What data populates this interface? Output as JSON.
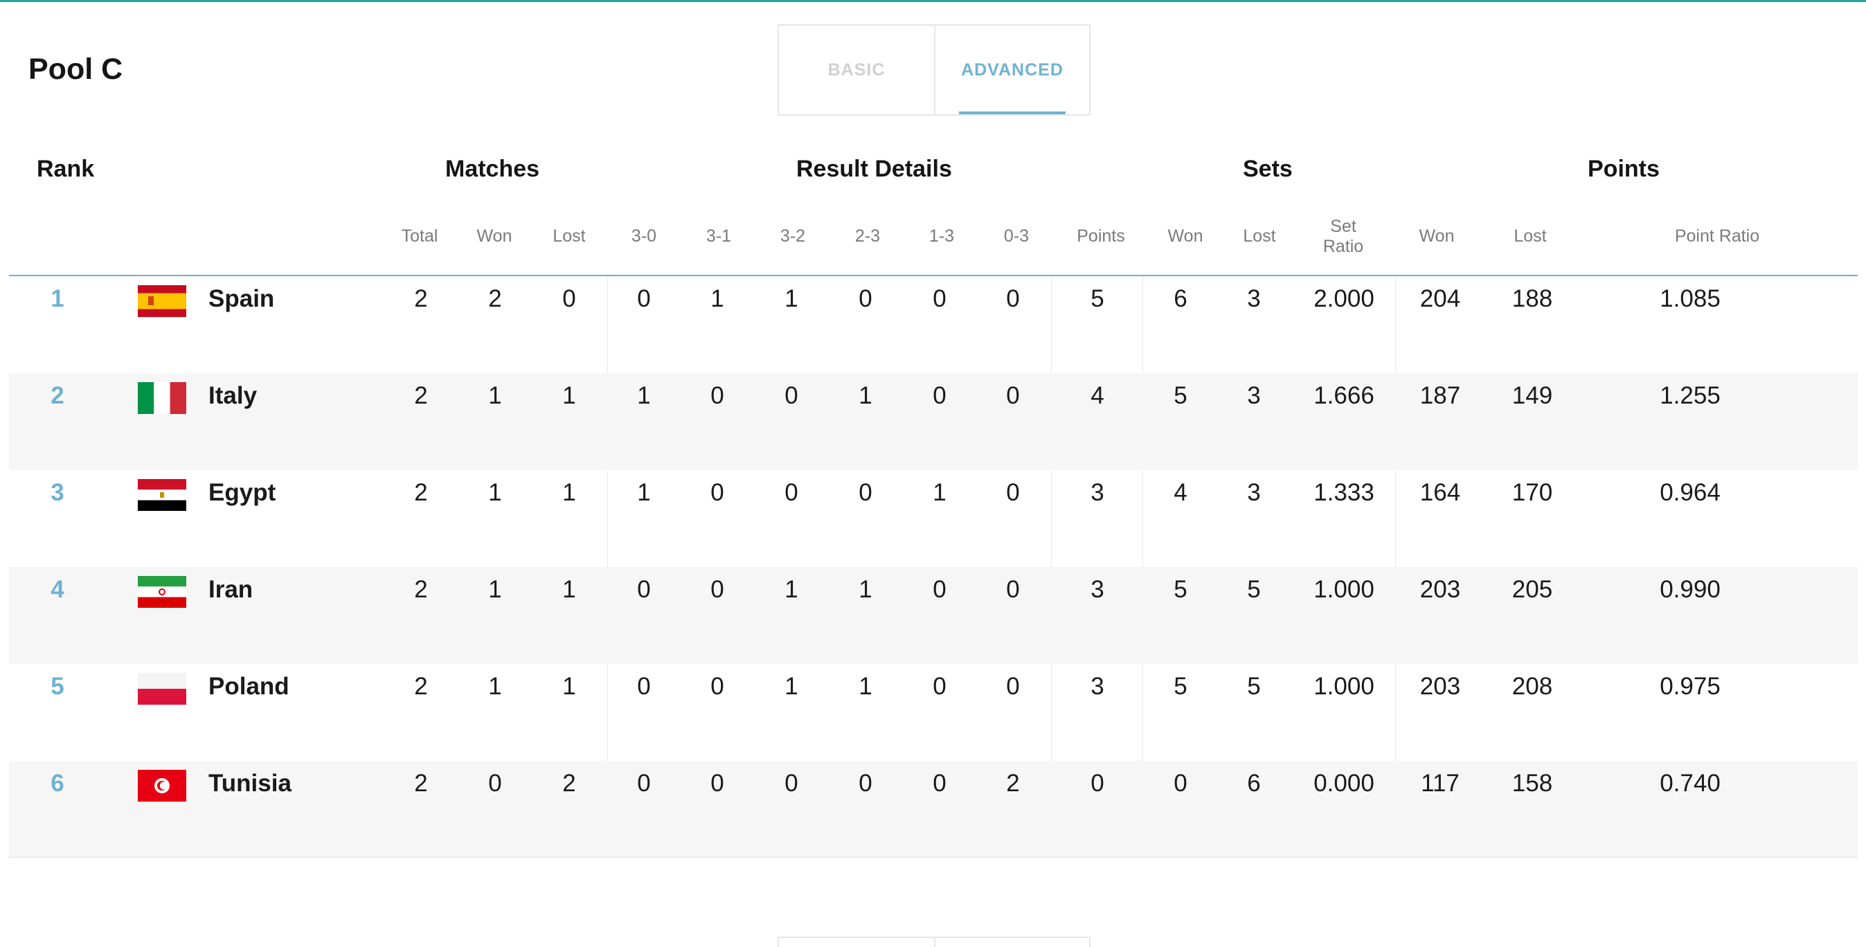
{
  "pool_title": "Pool C",
  "tabs": [
    {
      "label": "BASIC",
      "active": false
    },
    {
      "label": "ADVANCED",
      "active": true
    }
  ],
  "headers": {
    "rank": "Rank",
    "matches": "Matches",
    "result_details": "Result Details",
    "sets": "Sets",
    "points": "Points"
  },
  "subheaders": {
    "total": "Total",
    "won": "Won",
    "lost": "Lost",
    "r30": "3-0",
    "r31": "3-1",
    "r32": "3-2",
    "r23": "2-3",
    "r13": "1-3",
    "r03": "0-3",
    "points": "Points",
    "sets_won": "Won",
    "sets_lost": "Lost",
    "set_ratio_line1": "Set",
    "set_ratio_line2": "Ratio",
    "points_won": "Won",
    "points_lost": "Lost",
    "point_ratio": "Point Ratio"
  },
  "rows": [
    {
      "rank": "1",
      "team": "Spain",
      "flag": "spain-flag-icon",
      "total": "2",
      "won": "2",
      "lost": "0",
      "r30": "0",
      "r31": "1",
      "r32": "1",
      "r23": "0",
      "r13": "0",
      "r03": "0",
      "points": "5",
      "sets_won": "6",
      "sets_lost": "3",
      "set_ratio": "2.000",
      "points_won": "204",
      "points_lost": "188",
      "point_ratio": "1.085"
    },
    {
      "rank": "2",
      "team": "Italy",
      "flag": "italy-flag-icon",
      "total": "2",
      "won": "1",
      "lost": "1",
      "r30": "1",
      "r31": "0",
      "r32": "0",
      "r23": "1",
      "r13": "0",
      "r03": "0",
      "points": "4",
      "sets_won": "5",
      "sets_lost": "3",
      "set_ratio": "1.666",
      "points_won": "187",
      "points_lost": "149",
      "point_ratio": "1.255"
    },
    {
      "rank": "3",
      "team": "Egypt",
      "flag": "egypt-flag-icon",
      "total": "2",
      "won": "1",
      "lost": "1",
      "r30": "1",
      "r31": "0",
      "r32": "0",
      "r23": "0",
      "r13": "1",
      "r03": "0",
      "points": "3",
      "sets_won": "4",
      "sets_lost": "3",
      "set_ratio": "1.333",
      "points_won": "164",
      "points_lost": "170",
      "point_ratio": "0.964"
    },
    {
      "rank": "4",
      "team": "Iran",
      "flag": "iran-flag-icon",
      "total": "2",
      "won": "1",
      "lost": "1",
      "r30": "0",
      "r31": "0",
      "r32": "1",
      "r23": "1",
      "r13": "0",
      "r03": "0",
      "points": "3",
      "sets_won": "5",
      "sets_lost": "5",
      "set_ratio": "1.000",
      "points_won": "203",
      "points_lost": "205",
      "point_ratio": "0.990"
    },
    {
      "rank": "5",
      "team": "Poland",
      "flag": "poland-flag-icon",
      "total": "2",
      "won": "1",
      "lost": "1",
      "r30": "0",
      "r31": "0",
      "r32": "1",
      "r23": "1",
      "r13": "0",
      "r03": "0",
      "points": "3",
      "sets_won": "5",
      "sets_lost": "5",
      "set_ratio": "1.000",
      "points_won": "203",
      "points_lost": "208",
      "point_ratio": "0.975"
    },
    {
      "rank": "6",
      "team": "Tunisia",
      "flag": "tunisia-flag-icon",
      "total": "2",
      "won": "0",
      "lost": "2",
      "r30": "0",
      "r31": "0",
      "r32": "0",
      "r23": "0",
      "r13": "0",
      "r03": "2",
      "points": "0",
      "sets_won": "0",
      "sets_lost": "6",
      "set_ratio": "0.000",
      "points_won": "117",
      "points_lost": "158",
      "point_ratio": "0.740"
    }
  ],
  "colors": {
    "accent": "#6fb2d0",
    "top_bar": "#2aa3a0",
    "row_alt": "#f6f6f6"
  }
}
